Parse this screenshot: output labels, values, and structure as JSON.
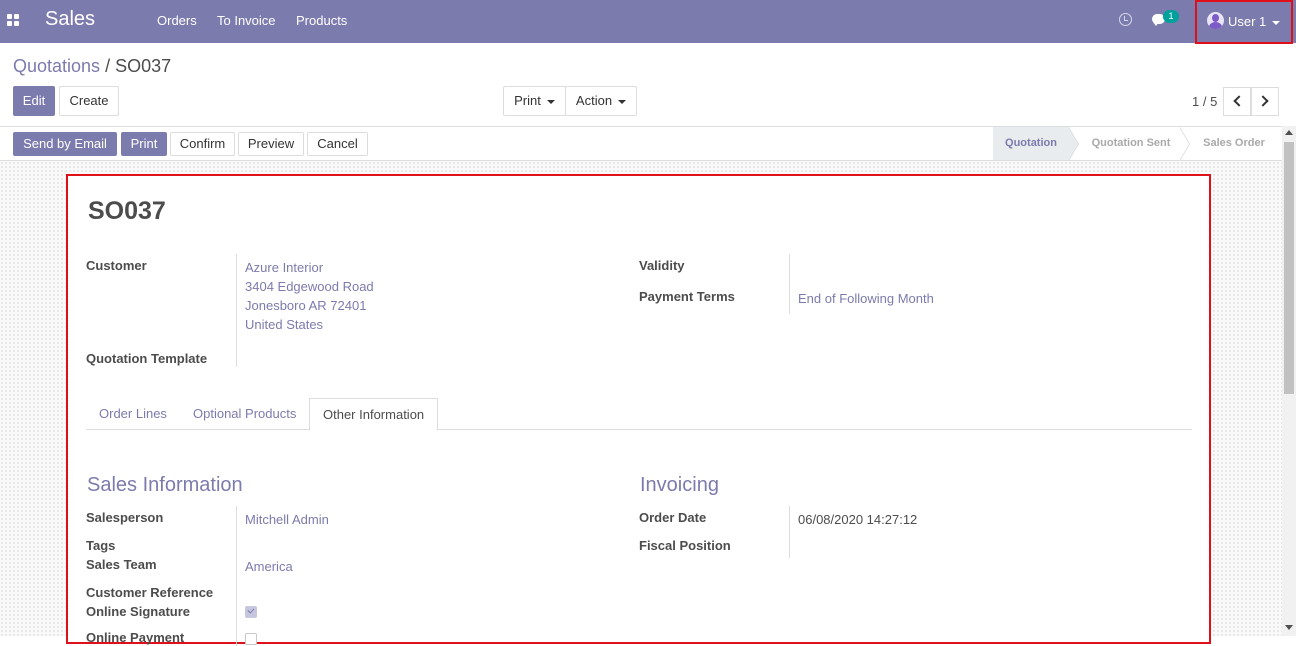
{
  "navbar": {
    "brand": "Sales",
    "menu": [
      "Orders",
      "To Invoice",
      "Products"
    ],
    "chat_count": "1",
    "user": "User 1"
  },
  "control": {
    "breadcrumb_parent": "Quotations",
    "breadcrumb_sep": "/",
    "breadcrumb_current": "SO037",
    "edit": "Edit",
    "create": "Create",
    "print": "Print",
    "action": "Action",
    "pager": "1 / 5"
  },
  "statusbar": {
    "buttons": [
      "Send by Email",
      "Print",
      "Confirm",
      "Preview",
      "Cancel"
    ],
    "stages": [
      "Quotation",
      "Quotation Sent",
      "Sales Order"
    ],
    "active_stage": "Quotation"
  },
  "sheet": {
    "name": "SO037",
    "customer_label": "Customer",
    "customer_lines": [
      "Azure Interior",
      "3404 Edgewood Road",
      "Jonesboro AR 72401",
      "United States"
    ],
    "quotation_template_label": "Quotation Template",
    "validity_label": "Validity",
    "payment_terms_label": "Payment Terms",
    "payment_terms_value": "End of Following Month",
    "tabs": [
      "Order Lines",
      "Optional Products",
      "Other Information"
    ],
    "active_tab": "Other Information",
    "sales_info_title": "Sales Information",
    "salesperson_label": "Salesperson",
    "salesperson_value": "Mitchell Admin",
    "tags_label": "Tags",
    "sales_team_label": "Sales Team",
    "sales_team_value": "America",
    "customer_reference_label": "Customer Reference",
    "online_signature_label": "Online Signature",
    "online_signature_checked": true,
    "online_payment_label": "Online Payment",
    "invoicing_title": "Invoicing",
    "order_date_label": "Order Date",
    "order_date_value": "06/08/2020 14:27:12",
    "fiscal_position_label": "Fiscal Position"
  },
  "colors": {
    "brand": "#7c7bad",
    "highlight_border": "#e0101a",
    "badge": "#00a09d"
  }
}
